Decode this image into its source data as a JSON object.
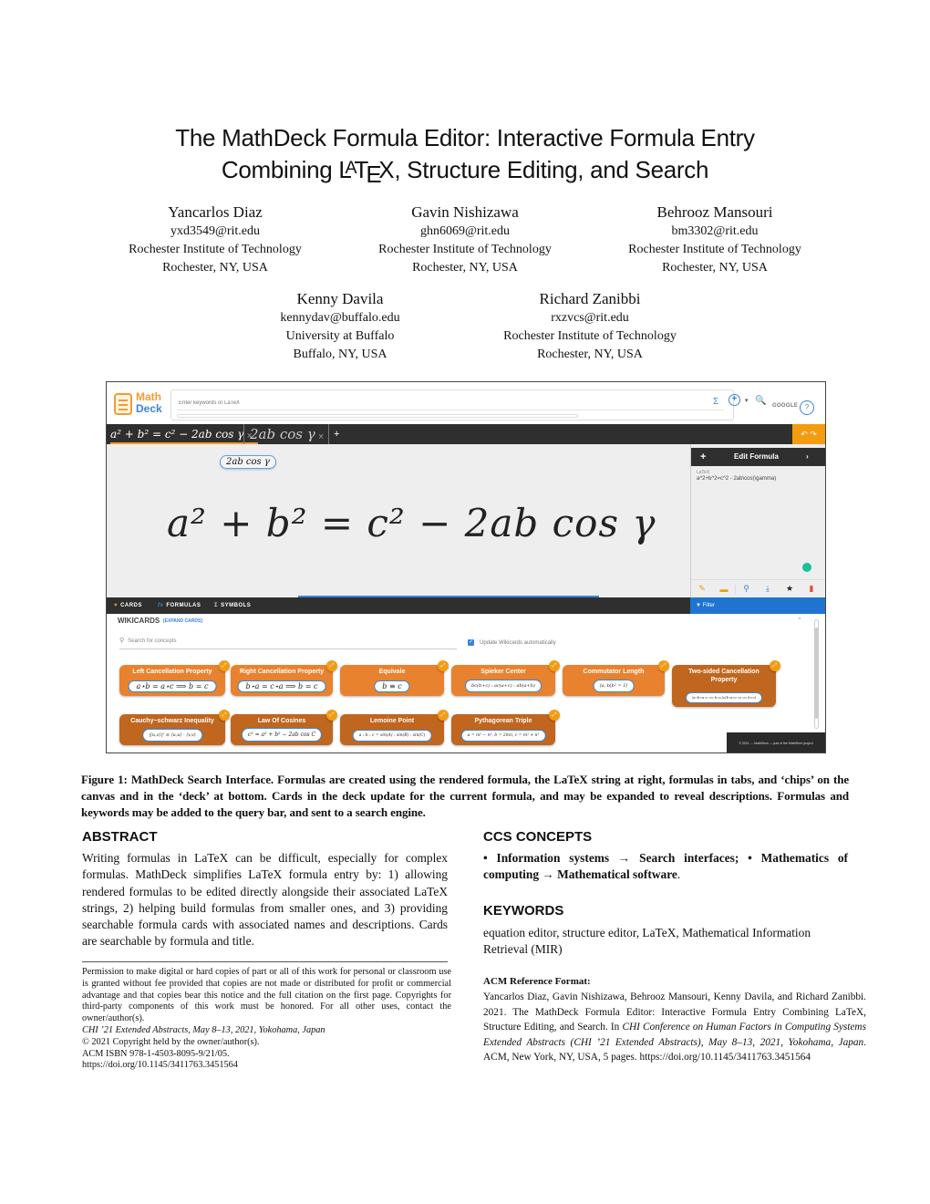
{
  "paper": {
    "title_line1": "The MathDeck Formula Editor: Interactive Formula Entry",
    "title_line2_pre": "Combining ",
    "title_line2_post": ", Structure Editing, and Search",
    "latex_L": "L",
    "latex_A": "A",
    "latex_T": "T",
    "latex_E": "E",
    "latex_X": "X"
  },
  "authors": [
    {
      "name": "Yancarlos Diaz",
      "email": "yxd3549@rit.edu",
      "affiliation": "Rochester Institute of Technology",
      "location": "Rochester, NY, USA"
    },
    {
      "name": "Gavin Nishizawa",
      "email": "ghn6069@rit.edu",
      "affiliation": "Rochester Institute of Technology",
      "location": "Rochester, NY, USA"
    },
    {
      "name": "Behrooz Mansouri",
      "email": "bm3302@rit.edu",
      "affiliation": "Rochester Institute of Technology",
      "location": "Rochester, NY, USA"
    },
    {
      "name": "Kenny Davila",
      "email": "kennydav@buffalo.edu",
      "affiliation": "University at Buffalo",
      "location": "Buffalo, NY, USA"
    },
    {
      "name": "Richard Zanibbi",
      "email": "rxzvcs@rit.edu",
      "affiliation": "Rochester Institute of Technology",
      "location": "Rochester, NY, USA"
    }
  ],
  "figure": {
    "app": {
      "logo_math": "Math",
      "logo_deck": "Deck",
      "search_placeholder": "Enter keywords or LaTeX",
      "sigma_icon": "Σ",
      "add_icon": "+",
      "caret_icon": "▾",
      "search_icon": "🔍",
      "engine_label": "GOOGLE",
      "help_icon": "?",
      "tabs": [
        {
          "label": "a² + b² = c² − 2ab cos γ",
          "close": "×"
        },
        {
          "label": "2ab cos γ",
          "close": "×"
        }
      ],
      "tab_add": "+",
      "undo_redo": "↶  ↷",
      "chip": "2ab cos γ",
      "main_formula": "a² + b² = c² − 2ab cos γ",
      "side_panel": {
        "plus": "+",
        "title": "Edit Formula",
        "chevron": "›",
        "latex_label": "LaTeX",
        "latex_value": "a^2+b^2=c^2 - 2ab\\cos(\\gamma)"
      },
      "tools": [
        "✎",
        "▬",
        "⚲",
        "⤓",
        "★",
        "▮"
      ],
      "deck_tabs": [
        {
          "icon": "♥",
          "label": "CARDS"
        },
        {
          "icon": "fx",
          "label": "FORMULAS"
        },
        {
          "icon": "Σ",
          "label": "SYMBOLS"
        }
      ],
      "filter_label": "Filter",
      "filter_icon": "▼",
      "wikicards_title": "WIKICARDS",
      "expand_cards": "[EXPAND CARDS]",
      "concept_search_placeholder": "Search for concepts",
      "update_auto_label": "Update Wikicards automatically",
      "update_auto_checked": true,
      "cards": [
        {
          "title": "Left Cancellation Property",
          "formula": "a⋆b = a⋆c ⟹ b = c"
        },
        {
          "title": "Right Cancellation Property",
          "formula": "b⋆a = c⋆a ⟹ b = c"
        },
        {
          "title": "Equivale",
          "formula": "b ≡ c"
        },
        {
          "title": "Spieker Center",
          "formula": "bc(b+c) : ac(a+c) : ab(a+b)"
        },
        {
          "title": "Commutator Length",
          "formula": "⟨a, b|b² = 1⟩"
        },
        {
          "title": "Two-sided Cancellation Property",
          "formula": "(a⋆b=a⋆c ⟹ b=c)∧(b⋆a=c⋆a ⟹ b=c)"
        },
        {
          "title": "Cauchy−schwarz Inequality",
          "formula": "|⟨u,v⟩|² ≤ ⟨u,u⟩ · ⟨v,v⟩"
        },
        {
          "title": "Law Of Cosines",
          "formula": "c² = a² + b² − 2ab cos C"
        },
        {
          "title": "Lemoine Point",
          "formula": "a : b : c = sin(A) : sin(B) : sin(C)"
        },
        {
          "title": "Pythagorean Triple",
          "formula": "a = m² − n², b = 2mn, c = m² + n²"
        }
      ],
      "expand_icon": "⤢",
      "footer_badge": "© 2021 — MathDeck — part of the MathSeer project"
    },
    "caption": "Figure 1: MathDeck Search Interface. Formulas are created using the rendered formula, the LaTeX string at right, formulas in tabs, and ‘chips’ on the canvas and in the ‘deck’ at bottom. Cards in the deck update for the current formula, and may be expanded to reveal descriptions. Formulas and keywords may be added to the query bar, and sent to a search engine."
  },
  "abstract": {
    "heading": "ABSTRACT",
    "text": "Writing formulas in LaTeX can be difficult, especially for complex formulas. MathDeck simplifies LaTeX formula entry by: 1) allowing rendered formulas to be edited directly alongside their associated LaTeX strings, 2) helping build formulas from smaller ones, and 3) providing searchable formula cards with associated names and descriptions. Cards are searchable by formula and title."
  },
  "ccs": {
    "heading": "CCS CONCEPTS",
    "text_bold": "• Information systems → Search interfaces; • Mathematics of computing → Mathematical software",
    "end": "."
  },
  "keywords": {
    "heading": "KEYWORDS",
    "text": "equation editor, structure editor, LaTeX, Mathematical Information Retrieval (MIR)"
  },
  "permission": {
    "text": "Permission to make digital or hard copies of part or all of this work for personal or classroom use is granted without fee provided that copies are not made or distributed for profit or commercial advantage and that copies bear this notice and the full citation on the first page. Copyrights for third-party components of this work must be honored. For all other uses, contact the owner/author(s).",
    "venue": "CHI ’21 Extended Abstracts, May 8–13, 2021, Yokohama, Japan",
    "copyright": "© 2021 Copyright held by the owner/author(s).",
    "isbn": "ACM ISBN 978-1-4503-8095-9/21/05.",
    "doi": "https://doi.org/10.1145/3411763.3451564"
  },
  "acm_reference": {
    "heading": "ACM Reference Format:",
    "part1": "Yancarlos Diaz, Gavin Nishizawa, Behrooz Mansouri, Kenny Davila, and Richard Zanibbi. 2021. The MathDeck Formula Editor: Interactive Formula Entry Combining LaTeX, Structure Editing, and Search. In ",
    "venue_italic": "CHI Conference on Human Factors in Computing Systems Extended Abstracts (CHI ’21 Extended Abstracts), May 8–13, 2021, Yokohama, Japan",
    "part2": ". ACM, New York, NY, USA, 5 pages. https://doi.org/10.1145/3411763.3451564"
  }
}
